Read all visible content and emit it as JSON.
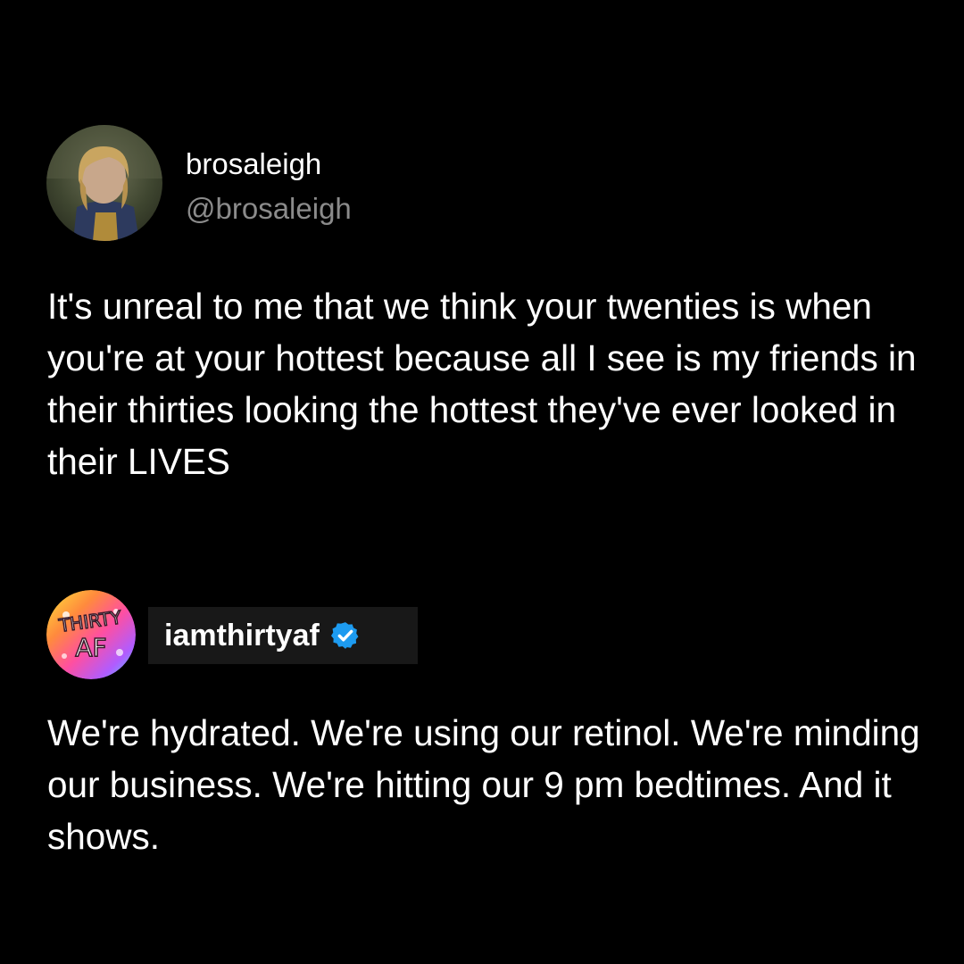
{
  "post": {
    "author_name": "brosaleigh",
    "author_handle": "@brosaleigh",
    "avatar_icon": "profile-photo-icon",
    "text": "It's unreal to me that we think your twenties is when you're at your hottest because all I see is my friends in their thirties looking the hottest they've ever looked in their LIVES"
  },
  "reply": {
    "account_name": "iamthirtyaf",
    "verified": true,
    "verified_icon": "verified-badge-icon",
    "verified_color": "#1d9bf0",
    "logo_text": [
      "THIRTY",
      "AF"
    ],
    "text": "We're hydrated. We're using our retinol. We're minding our business. We're hitting our 9 pm bedtimes. And it shows."
  },
  "colors": {
    "background": "#000000",
    "text": "#ffffff",
    "handle": "#8b8b8b"
  }
}
